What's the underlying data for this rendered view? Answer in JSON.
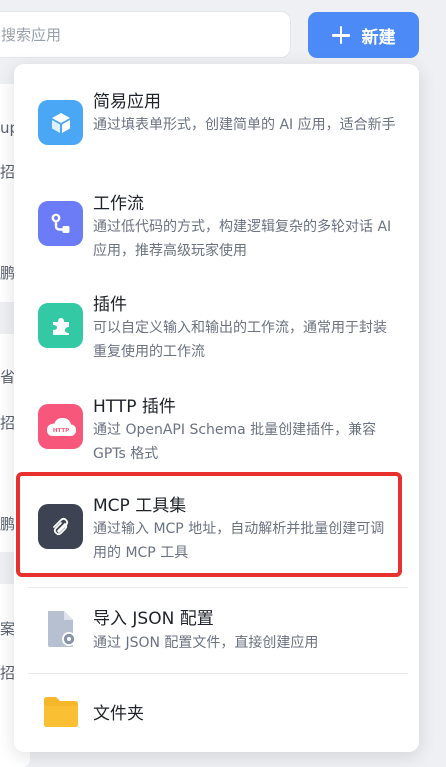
{
  "search": {
    "placeholder": "搜索应用"
  },
  "toolbar": {
    "new_label": "新建"
  },
  "background": {
    "fragments": [
      "up",
      "招",
      "鹏",
      "省",
      "招",
      "鹏",
      "案",
      "招"
    ]
  },
  "menu": {
    "items": [
      {
        "title": "简易应用",
        "desc": "通过填表单形式，创建简单的 AI 应用，适合新手",
        "icon": "cube-icon",
        "color": "#4aa7f5"
      },
      {
        "title": "工作流",
        "desc": "通过低代码的方式，构建逻辑复杂的多轮对话 AI 应用，推荐高级玩家使用",
        "icon": "workflow-icon",
        "color": "#6b7cf6"
      },
      {
        "title": "插件",
        "desc": "可以自定义输入和输出的工作流，通常用于封装重复使用的工作流",
        "icon": "puzzle-icon",
        "color": "#33c9a4"
      },
      {
        "title": "HTTP 插件",
        "desc": "通过 OpenAPI Schema 批量创建插件，兼容 GPTs 格式",
        "icon": "http-cloud-icon",
        "color": "#f7577a",
        "badge": "HTTP"
      },
      {
        "title": "MCP 工具集",
        "desc": "通过输入 MCP 地址，自动解析并批量创建可调用的 MCP 工具",
        "icon": "mcp-icon",
        "color": "#3d4352"
      },
      {
        "title": "导入 JSON 配置",
        "desc": "通过 JSON 配置文件，直接创建应用",
        "icon": "json-file-icon",
        "color": "#9aa6bd"
      },
      {
        "title": "文件夹",
        "desc": "",
        "icon": "folder-icon",
        "color": "#f7b72b"
      }
    ]
  }
}
